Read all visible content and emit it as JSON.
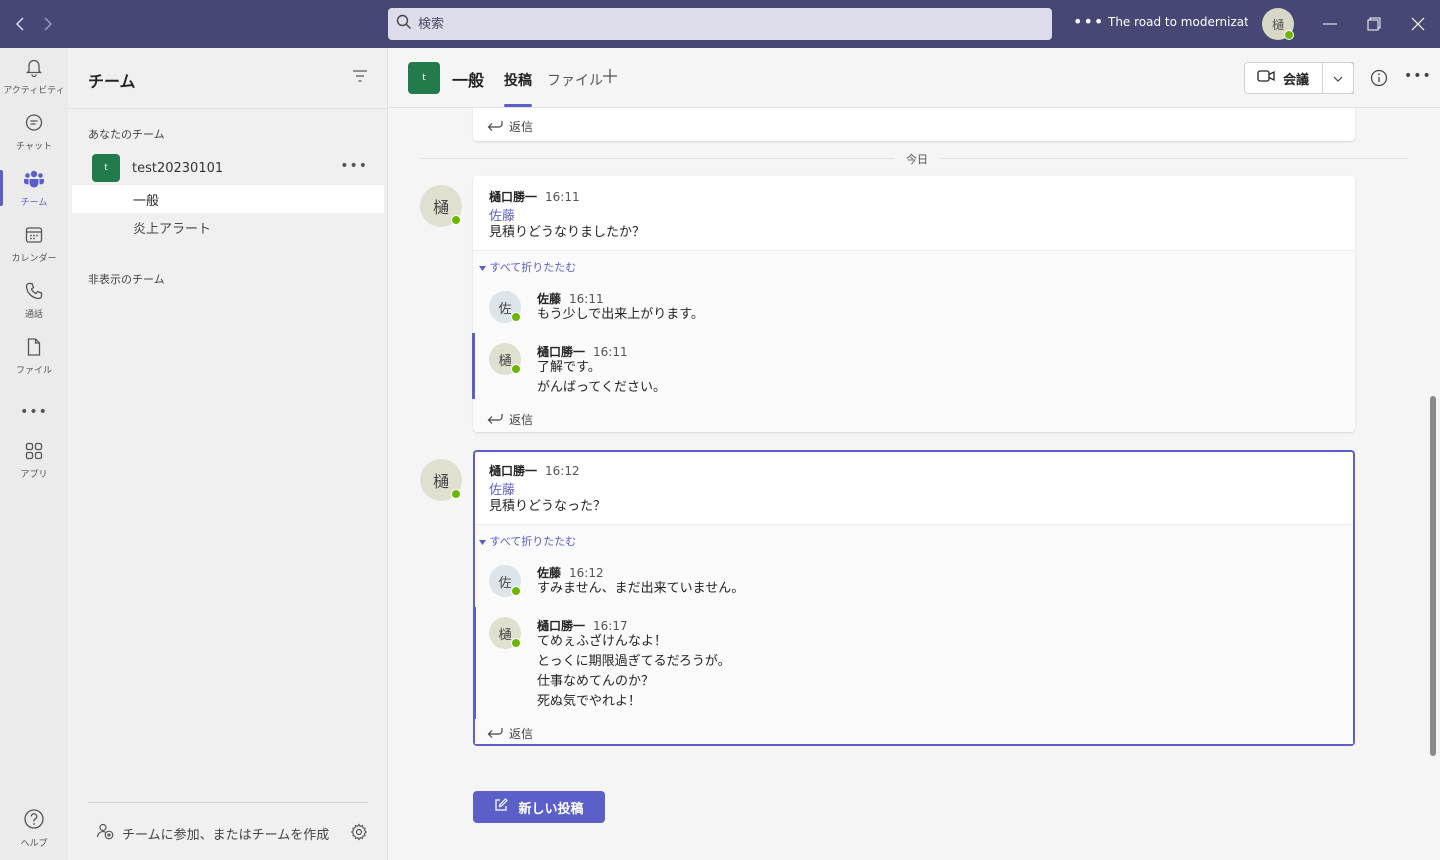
{
  "titlebar": {
    "search_placeholder": "検索",
    "org_title": "The road to modernizati...",
    "user_initial": "樋"
  },
  "rail": {
    "items": [
      {
        "label": "アクティビティ",
        "icon": "bell-icon"
      },
      {
        "label": "チャット",
        "icon": "chat-icon"
      },
      {
        "label": "チーム",
        "icon": "teams-icon"
      },
      {
        "label": "カレンダー",
        "icon": "calendar-icon"
      },
      {
        "label": "通話",
        "icon": "phone-icon"
      },
      {
        "label": "ファイル",
        "icon": "file-icon"
      },
      {
        "label": "アプリ",
        "icon": "apps-icon"
      },
      {
        "label": "ヘルプ",
        "icon": "help-icon"
      }
    ]
  },
  "panel": {
    "title": "チーム",
    "your_teams_label": "あなたのチーム",
    "team": {
      "initial": "t",
      "name": "test20230101"
    },
    "channels": [
      "一般",
      "炎上アラート"
    ],
    "hidden_teams_label": "非表示のチーム",
    "join_label": "チームに参加、またはチームを作成"
  },
  "header": {
    "channel_initial": "t",
    "channel_name": "一般",
    "tabs": [
      "投稿",
      "ファイル"
    ],
    "meet_label": "会議"
  },
  "conversation": {
    "prev_reply_label": "返信",
    "date_divider": "今日",
    "threads": [
      {
        "author": "樋口勝一",
        "author_initial": "樋",
        "time": "16:11",
        "mention": "佐藤",
        "body": "見積りどうなりましたか？",
        "collapse_label": "すべて折りたたむ",
        "replies": [
          {
            "author": "佐藤",
            "initial": "佐",
            "time": "16:11",
            "lines": [
              "もう少しで出来上がります。"
            ]
          },
          {
            "author": "樋口勝一",
            "initial": "樋",
            "time": "16:11",
            "lines": [
              "了解です。",
              "がんばってください。"
            ]
          }
        ],
        "reply_label": "返信"
      },
      {
        "author": "樋口勝一",
        "author_initial": "樋",
        "time": "16:12",
        "mention": "佐藤",
        "body": "見積りどうなった？",
        "collapse_label": "すべて折りたたむ",
        "replies": [
          {
            "author": "佐藤",
            "initial": "佐",
            "time": "16:12",
            "lines": [
              "すみません、まだ出来ていません。"
            ]
          },
          {
            "author": "樋口勝一",
            "initial": "樋",
            "time": "16:17",
            "lines": [
              "てめぇふざけんなよ！",
              "とっくに期限過ぎてるだろうが。",
              "仕事なめてんのか？",
              "死ぬ気でやれよ！"
            ]
          }
        ],
        "reply_label": "返信"
      }
    ],
    "new_post_label": "新しい投稿"
  },
  "colors": {
    "titlebar": "#464775",
    "accent": "#5b5fc7",
    "team_green": "#237b4b",
    "presence_green": "#6bb700"
  }
}
